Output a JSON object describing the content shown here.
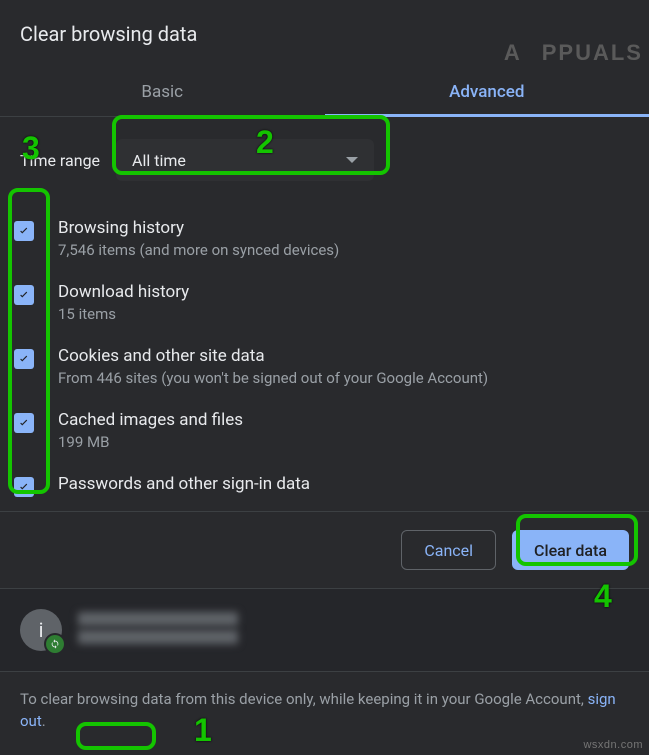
{
  "dialog": {
    "title": "Clear browsing data",
    "tabs": {
      "basic": "Basic",
      "advanced": "Advanced",
      "active": "advanced"
    },
    "time_range": {
      "label": "Time range",
      "value": "All time"
    },
    "options": [
      {
        "title": "Browsing history",
        "sub": "7,546 items (and more on synced devices)",
        "checked": true
      },
      {
        "title": "Download history",
        "sub": "15 items",
        "checked": true
      },
      {
        "title": "Cookies and other site data",
        "sub": "From 446 sites (you won't be signed out of your Google Account)",
        "checked": true
      },
      {
        "title": "Cached images and files",
        "sub": "199 MB",
        "checked": true
      },
      {
        "title": "Passwords and other sign-in data",
        "sub": "",
        "checked": true
      }
    ],
    "buttons": {
      "cancel": "Cancel",
      "clear": "Clear data"
    },
    "account": {
      "initial": "i"
    },
    "footer": {
      "pre": "To clear browsing data from this device only, while keeping it in your Google Account, ",
      "link": "sign out",
      "post": "."
    }
  },
  "annotations": {
    "1": "1",
    "2": "2",
    "3": "3",
    "4": "4"
  },
  "watermark": {
    "top": "A puals",
    "bottom": "wsxdn.com"
  }
}
